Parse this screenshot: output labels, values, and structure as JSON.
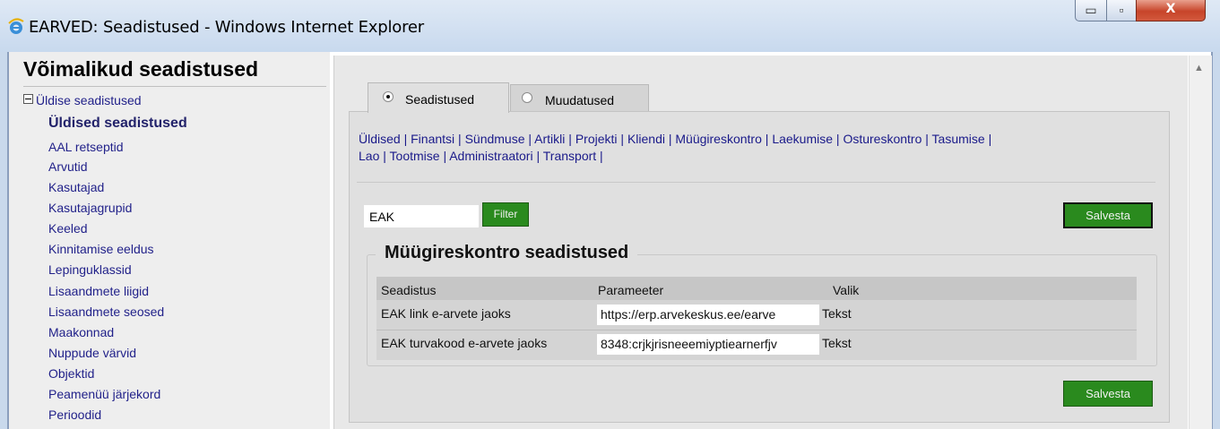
{
  "window": {
    "title": "EARVED: Seadistused - Windows Internet Explorer",
    "icon": "ie-icon",
    "controls": {
      "minimize": "▭",
      "maximize": "▫",
      "close": "X"
    }
  },
  "sidebar": {
    "title": "Võimalikud seadistused",
    "root": "Üldise seadistused",
    "items": [
      {
        "label": "Üldised seadistused",
        "active": true
      },
      {
        "label": "AAL retseptid"
      },
      {
        "label": "Arvutid"
      },
      {
        "label": "Kasutajad"
      },
      {
        "label": "Kasutajagrupid"
      },
      {
        "label": "Keeled"
      },
      {
        "label": "Kinnitamise eeldus"
      },
      {
        "label": "Lepinguklassid"
      },
      {
        "label": "Lisaandmete liigid"
      },
      {
        "label": "Lisaandmete seosed"
      },
      {
        "label": "Maakonnad"
      },
      {
        "label": "Nuppude värvid"
      },
      {
        "label": "Objektid"
      },
      {
        "label": "Peamenüü järjekord"
      },
      {
        "label": "Perioodid"
      }
    ]
  },
  "tabs": [
    {
      "label": "Seadistused",
      "selected": true
    },
    {
      "label": "Muudatused",
      "selected": false
    }
  ],
  "categories": [
    "Üldised",
    "Finantsi",
    "Sündmuse",
    "Artikli",
    "Projekti",
    "Kliendi",
    "Müügireskontro",
    "Laekumise",
    "Ostureskontro",
    "Tasumise",
    "Lao",
    "Tootmise",
    "Administraatori",
    "Transport"
  ],
  "filter": {
    "value": "EAK",
    "button": "Filter"
  },
  "save_label": "Salvesta",
  "section": {
    "title": "Müügireskontro seadistused",
    "headers": [
      "Seadistus",
      "Parameeter",
      "Valik"
    ],
    "rows": [
      {
        "name": "EAK link e-arvete jaoks",
        "value": "https://erp.arvekeskus.ee/earve",
        "option": "Tekst"
      },
      {
        "name": "EAK turvakood e-arvete jaoks",
        "value": "8348:crjkjrisneeemiyptiearnerfjv",
        "option": "Tekst"
      }
    ]
  },
  "colors": {
    "save_green": "#2a8a1e",
    "link_blue": "#1a1a8a"
  }
}
